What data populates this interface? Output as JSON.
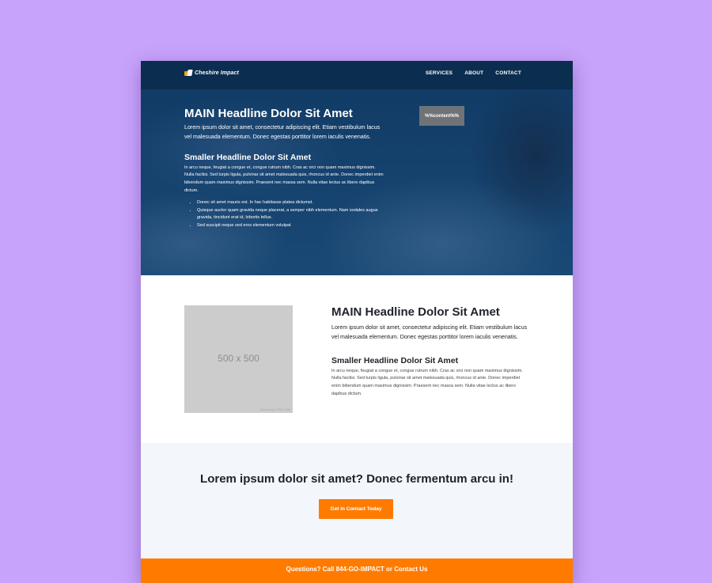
{
  "header": {
    "logo_text": "Cheshire Impact",
    "nav": [
      "SERVICES",
      "ABOUT",
      "CONTACT"
    ]
  },
  "hero": {
    "title": "MAIN Headline Dolor Sit Amet",
    "lead": "Lorem ipsum dolor sit amet, consectetur adipiscing elit. Etiam vestibulum lacus vel malesuada elementum. Donec egestas porttitor lorem iaculis venenatis.",
    "subtitle": "Smaller Headline Dolor Sit Amet",
    "body": "In arcu neque, feugiat a congue et, congue rutrum nibh. Cras ac orci non quam maximus dignissim. Nulla facilisi. Sed turpis ligula, pulvinar sit amet malesuada quis, rhoncus id ante. Donec imperdiet enim bibendum quam maximus dignissim. Praesent nec massa sem. Nulla vitae lectus ac libero dapibus dictum.",
    "bullets": [
      "Donec sit amet mauris est. In hac habitasse platea dictumst.",
      "Quisque auctor quam gravida neque placerat, a semper nibh elementum. Nam sodales augue gravida, tincidunt erat id, lobortis tellus.",
      "Sed suscipit neque sed eros elementum volutpat"
    ],
    "badge": "%%content%%"
  },
  "feature": {
    "placeholder_label": "500 x 500",
    "placeholder_credit": "Powered by HTML.COM",
    "title": "MAIN Headline Dolor Sit Amet",
    "lead": "Lorem ipsum dolor sit amet, consectetur adipiscing elit. Etiam vestibulum lacus vel malesuada elementum. Donec egestas porttitor lorem iaculis venenatis.",
    "subtitle": "Smaller Headline Dolor Sit Amet",
    "body": "In arcu neque, feugiat a congue et, congue rutrum nibh. Cras ac orci non quam maximus dignissim. Nulla facilisi. Sed turpis ligula, pulvinar sit amet malesuada quis, rhoncus id ante. Donec imperdiet enim bibendum quam maximus dignissim. Praesent nec massa sem. Nulla vitae lectus ac libero dapibus dictum."
  },
  "cta": {
    "title": "Lorem ipsum dolor sit amet? Donec fermentum arcu in!",
    "button_label": "Get in Contact Today"
  },
  "footer": {
    "text": "Questions? Call 844-GO-IMPACT or Contact Us"
  },
  "colors": {
    "background": "#c7a3fb",
    "accent": "#ff7b00",
    "hero": "#14406c"
  }
}
